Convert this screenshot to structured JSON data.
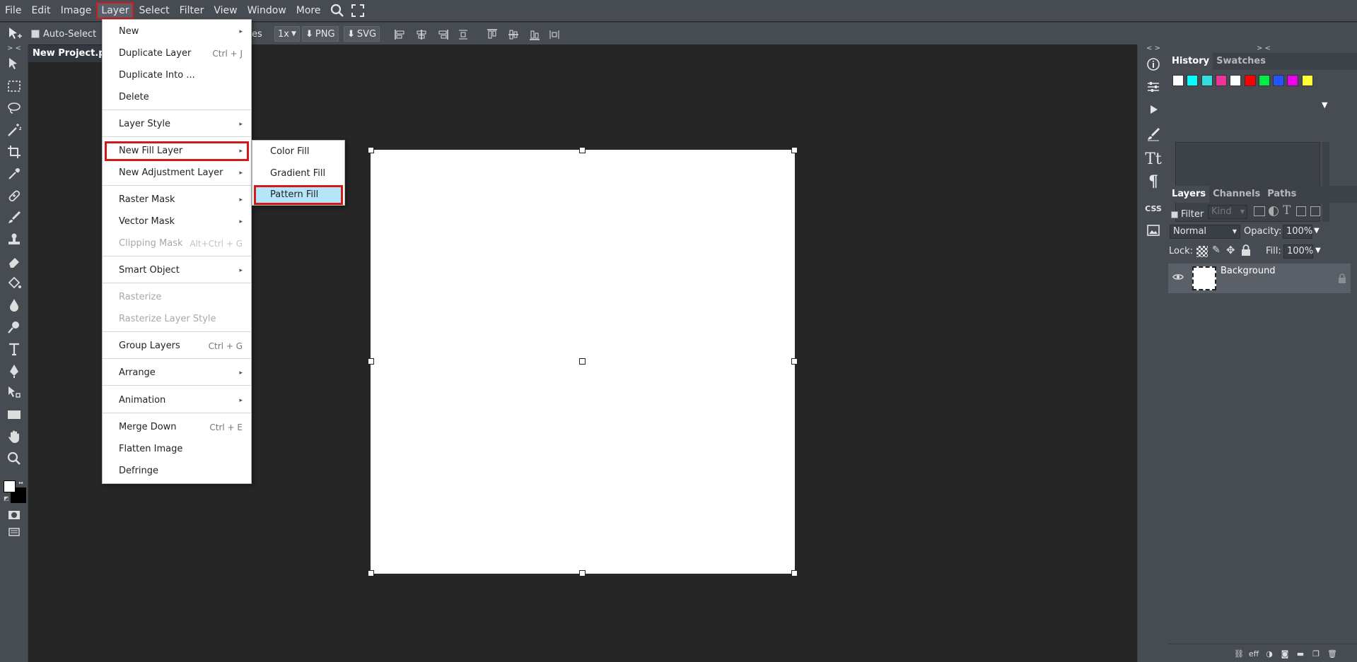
{
  "menubar": {
    "items": [
      "File",
      "Edit",
      "Image",
      "Layer",
      "Select",
      "Filter",
      "View",
      "Window",
      "More"
    ],
    "active": "Layer"
  },
  "options_bar": {
    "auto_select_label": "Auto-Select",
    "partial_label": "es",
    "scale": "1x",
    "png_label": "PNG",
    "svg_label": "SVG"
  },
  "document": {
    "tab_title": "New Project.psd"
  },
  "layer_menu": {
    "items": [
      {
        "label": "New",
        "submenu": true
      },
      {
        "label": "Duplicate Layer",
        "shortcut": "Ctrl + J"
      },
      {
        "label": "Duplicate Into ..."
      },
      {
        "label": "Delete"
      },
      {
        "label": "Layer Style",
        "submenu": true
      },
      {
        "label": "New Fill Layer",
        "submenu": true,
        "highlighted": true
      },
      {
        "label": "New Adjustment Layer",
        "submenu": true
      },
      {
        "label": "Raster Mask",
        "submenu": true
      },
      {
        "label": "Vector Mask",
        "submenu": true
      },
      {
        "label": "Clipping Mask",
        "shortcut": "Alt+Ctrl + G",
        "disabled": true
      },
      {
        "label": "Smart Object",
        "submenu": true
      },
      {
        "label": "Rasterize",
        "disabled": true
      },
      {
        "label": "Rasterize Layer Style",
        "disabled": true
      },
      {
        "label": "Group Layers",
        "shortcut": "Ctrl + G"
      },
      {
        "label": "Arrange",
        "submenu": true
      },
      {
        "label": "Animation",
        "submenu": true
      },
      {
        "label": "Merge Down",
        "shortcut": "Ctrl + E"
      },
      {
        "label": "Flatten Image"
      },
      {
        "label": "Defringe"
      }
    ]
  },
  "fill_submenu": {
    "items": [
      "Color Fill",
      "Gradient Fill",
      "Pattern Fill"
    ],
    "selected": "Pattern Fill"
  },
  "history_panel": {
    "tabs": [
      "History",
      "Swatches"
    ],
    "swatch_colors": [
      "#ffffff",
      "#00ffff",
      "#33dddd",
      "#ee3399",
      "#ffffff",
      "#ff0000",
      "#00ee44",
      "#2255ff",
      "#ee00ee",
      "#ffff33"
    ]
  },
  "layers_panel": {
    "tabs": [
      "Layers",
      "Channels",
      "Paths"
    ],
    "filter_label": "Filter",
    "kind_placeholder": "Kind",
    "blend_mode": "Normal",
    "opacity_label": "Opacity:",
    "opacity_value": "100%",
    "lock_label": "Lock:",
    "fill_label": "Fill:",
    "fill_value": "100%",
    "layers": [
      {
        "name": "Background",
        "locked": true,
        "visible": true
      }
    ],
    "bottom_eff": "eff"
  },
  "right_strip": {
    "css_label": "CSS"
  },
  "colors": {
    "highlight_outline": "#d11a1a",
    "selected_item_bg": "#b5e5fb",
    "ui_panel": "#474c53",
    "workspace": "#262626",
    "foreground_color": "#ffffff",
    "background_color": "#000000"
  }
}
